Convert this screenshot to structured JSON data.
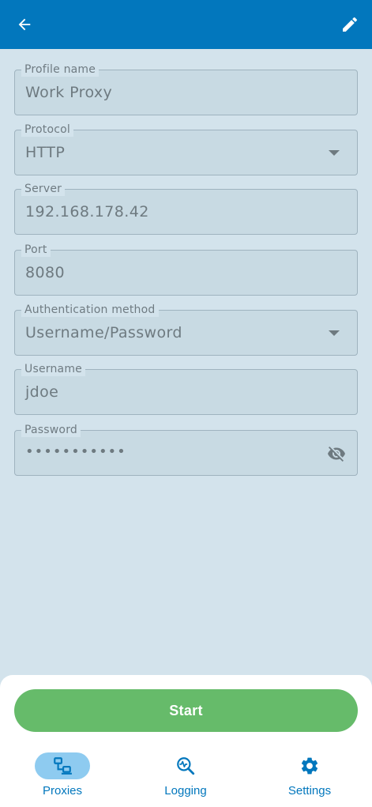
{
  "fields": [
    {
      "label": "Profile name",
      "value": "Work Proxy"
    },
    {
      "label": "Protocol",
      "value": "HTTP"
    },
    {
      "label": "Server",
      "value": "192.168.178.42"
    },
    {
      "label": "Port",
      "value": "8080"
    },
    {
      "label": "Authentication method",
      "value": "Username/Password"
    },
    {
      "label": "Username",
      "value": "jdoe"
    },
    {
      "label": "Password",
      "value": "•••••••••••"
    }
  ],
  "start_label": "Start",
  "nav": [
    {
      "label": "Proxies",
      "icon": "proxies-icon",
      "active": true
    },
    {
      "label": "Logging",
      "icon": "logging-icon",
      "active": false
    },
    {
      "label": "Settings",
      "icon": "gear-icon",
      "active": false
    }
  ],
  "colors": {
    "accent": "#0277bd",
    "start": "#66bb6a",
    "background": "#d3e3ec"
  }
}
